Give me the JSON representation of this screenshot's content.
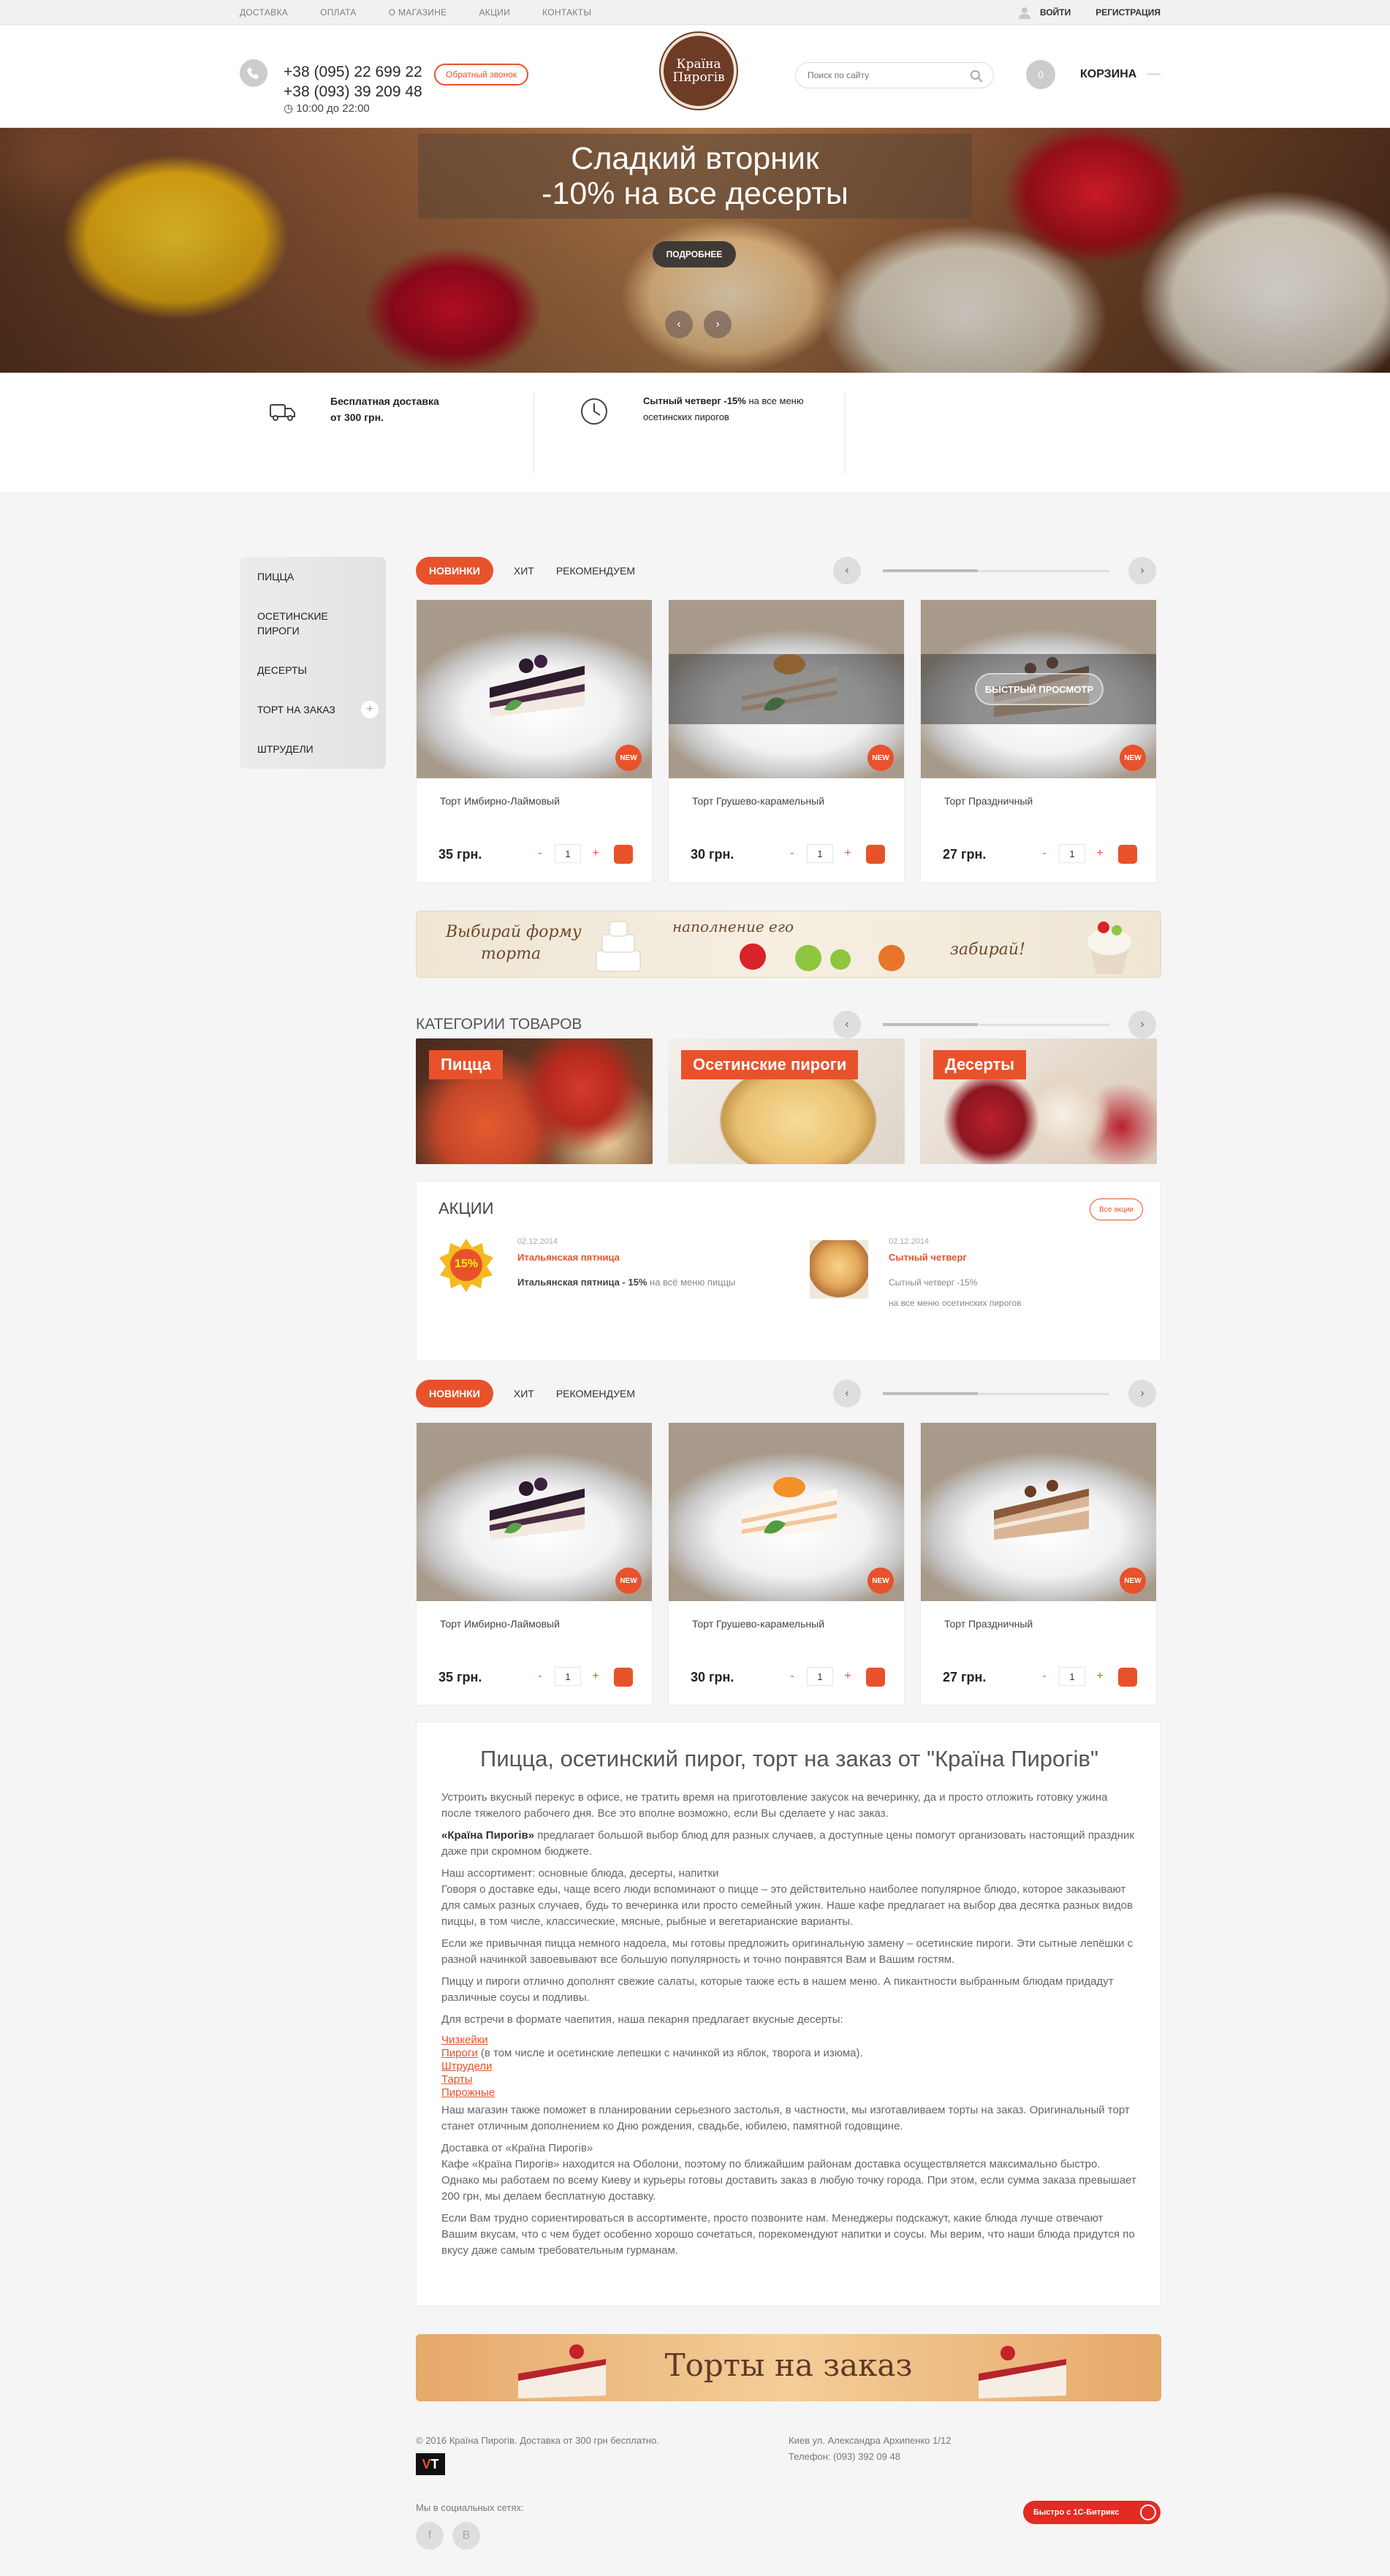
{
  "topbar": {
    "nav": [
      "ДОСТАВКА",
      "ОПЛАТА",
      "О МАГАЗИНЕ",
      "АКЦИИ",
      "КОНТАКТЫ"
    ],
    "login": "ВОЙТИ",
    "register": "РЕГИСТРАЦИЯ"
  },
  "header": {
    "phone1": "+38 (095) 22 699 22",
    "phone2": "+38 (093) 39 209 48",
    "hours": "10:00 до 22:00",
    "callback": "Обратный звонок",
    "logo_line1": "Країна",
    "logo_line2": "Пирогів",
    "search_placeholder": "Поиск по сайту",
    "cart_count": "0",
    "cart_label": "КОРЗИНА"
  },
  "hero": {
    "title": "Сладкий вторник",
    "subtitle_bold": "-10%",
    "subtitle_rest": " на все десерты",
    "more": "ПОДРОБНЕЕ"
  },
  "perks": {
    "delivery_line1": "Бесплатная доставка",
    "delivery_line2": "от 300 грн.",
    "thursday_bold": "Сытный четверг -15%",
    "thursday_rest": " на все меню",
    "thursday_line2": "осетинских пирогов"
  },
  "sidebar": {
    "items": [
      "ПИЦЦА",
      "ОСЕТИНСКИЕ",
      "ПИРОГИ",
      "ДЕСЕРТЫ",
      "ТОРТ НА ЗАКАЗ",
      "ШТРУДЕЛИ"
    ],
    "plus": "+"
  },
  "tabs": {
    "new": "НОВИНКИ",
    "hit": "ХИТ",
    "recommend": "РЕКОМЕНДУЕМ"
  },
  "products": [
    {
      "name": "Торт Имбирно-Лаймовый",
      "price": "35 грн.",
      "qty": "1",
      "badge": "NEW"
    },
    {
      "name": "Торт Грушево-карамельный",
      "price": "30 грн.",
      "qty": "1",
      "badge": "NEW"
    },
    {
      "name": "Торт Праздничный",
      "price": "27 грн.",
      "qty": "1",
      "badge": "NEW"
    }
  ],
  "quick_view": "БЫСТРЫЙ ПРОСМОТР",
  "banner1": {
    "text1": "Выбирай форму",
    "text2": "торта",
    "text3": "наполнение его",
    "text4": "забирай!"
  },
  "categories": {
    "title": "КАТЕГОРИИ ТОВАРОВ",
    "items": [
      "Пицца",
      "Осетинские пироги",
      "Десерты"
    ]
  },
  "promo": {
    "title": "АКЦИИ",
    "all": "Все акции",
    "badge": "15%",
    "p1_date": "02.12.2014",
    "p1_title": "Итальянская пятница",
    "p1_desc_bold": "Итальянская пятница - 15%",
    "p1_desc_rest": " на всё меню пиццы",
    "p2_date": "02.12.2014",
    "p2_title": "Сытный четверг",
    "p2_desc1": "Сытный четверг -15%",
    "p2_desc2": "на все меню осетинских пирогов"
  },
  "seo": {
    "title": "Пицца, осетинский пирог, торт на заказ от \"Країна Пирогів\"",
    "p1": "Устроить вкусный перекус в офисе, не тратить время на приготовление закусок на вечеринку, да и просто отложить готовку ужина после тяжелого рабочего дня. Все это вполне возможно, если Вы сделаете у нас заказ.",
    "p2_bold": "«Країна Пирогів»",
    "p2_rest": " предлагает большой выбор блюд для разных случаев, а доступные цены помогут организовать настоящий праздник даже при скромном бюджете.",
    "p3": "Наш ассортимент: основные блюда, десерты, напитки",
    "p4": "Говоря о доставке еды, чаще всего люди вспоминают о пицце – это действительно наиболее популярное блюдо, которое заказывают для самых разных случаев, будь то вечеринка или просто семейный ужин. Наше кафе предлагает на выбор два десятка разных видов пиццы, в том числе, классические, мясные, рыбные и вегетарианские варианты.",
    "p5": "Если же привычная пицца немного надоела, мы готовы предложить оригинальную замену – осетинские пироги. Эти сытные лепёшки с разной начинкой завоевывают все большую популярность и точно понравятся Вам и Вашим гостям.",
    "p6": "Пиццу и пироги отлично дополнят свежие салаты, которые также есть в нашем меню. А пикантности выбранным блюдам придадут различные соусы и подливы.",
    "p7": "Для встречи в формате чаепития, наша пекарня предлагает вкусные десерты:",
    "link1": "Чизкейки",
    "link2": "Пироги",
    "link2_rest": " (в том числе и осетинские лепешки с начинкой из яблок, творога и изюма).",
    "link3": "Штрудели",
    "link4": "Тарты",
    "link5": "Пирожные",
    "p8": "Наш магазин также поможет в планировании серьезного застолья, в частности, мы изготавливаем торты на заказ. Оригинальный торт станет отличным дополнением ко Дню рождения, свадьбе, юбилею, памятной годовщине.",
    "p9": "Доставка от «Країна Пирогів»",
    "p10": "Кафе «Країна Пирогів» находится на Оболони, поэтому по ближайшим районам доставка осуществляется максимально быстро. Однако мы работаем по всему Киеву и курьеры готовы доставить заказ в любую точку города. При этом, если сумма заказа превышает 200 грн, мы делаем бесплатную доставку.",
    "p11": "Если Вам трудно сориентироваться в ассортименте, просто позвоните нам. Менеджеры подскажут, какие блюда лучше отвечают Вашим вкусам, что с чем будет особенно хорошо сочетаться, порекомендуют напитки и соусы. Мы верим, что наши блюда придутся по вкусу даже самым требовательным гурманам."
  },
  "banner2": {
    "text": "Торты на заказ"
  },
  "footer": {
    "copyright": "© 2016 Країна Пирогів. Доставка от 300 грн бесплатно.",
    "address": "Киев ул. Александра Архипенко 1/12",
    "phone": "Телефон: (093) 392 09 48",
    "vt_v": "V",
    "vt_t": "T",
    "social_label": "Мы в социальных сетях:",
    "fb": "f",
    "vk": "B",
    "bitrix": "Быстро с 1С-Битрикс"
  },
  "colors": {
    "accent": "#e8522b",
    "logo": "#6d3b26"
  }
}
